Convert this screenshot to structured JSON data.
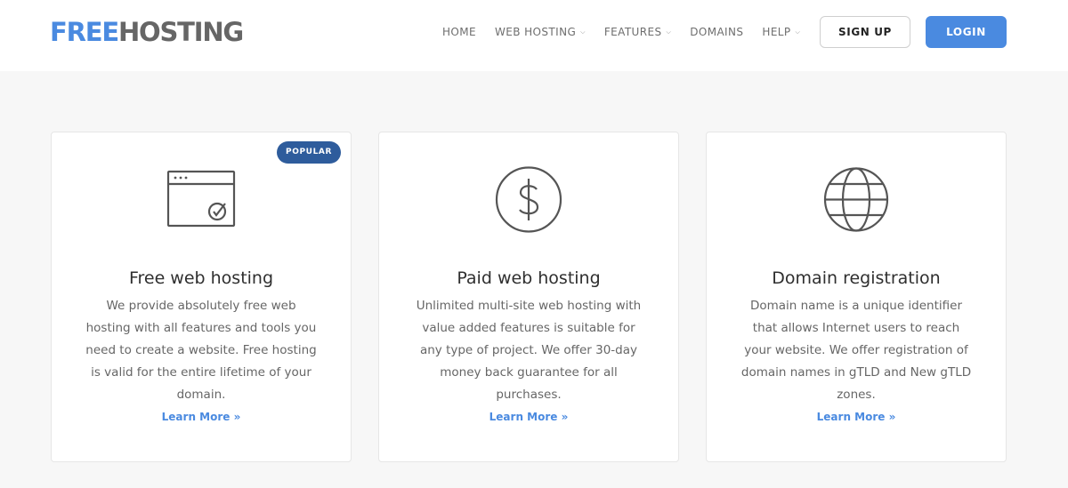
{
  "brand": {
    "logo_part1": "FREE",
    "logo_part2": "HOSTING",
    "primary_color": "#4a8ae0",
    "secondary_color": "#666666"
  },
  "nav": {
    "items": [
      {
        "label": "HOME",
        "has_dropdown": false
      },
      {
        "label": "WEB HOSTING",
        "has_dropdown": true
      },
      {
        "label": "FEATURES",
        "has_dropdown": true
      },
      {
        "label": "DOMAINS",
        "has_dropdown": false
      },
      {
        "label": "HELP",
        "has_dropdown": true
      }
    ]
  },
  "auth": {
    "signup_label": "SIGN UP",
    "login_label": "LOGIN"
  },
  "cards": [
    {
      "icon": "browser-check-icon",
      "badge": "POPULAR",
      "title": "Free web hosting",
      "description": "We provide absolutely free web hosting with all features and tools you need to create a website. Free hosting is valid for the entire lifetime of your domain.",
      "link": "Learn More »"
    },
    {
      "icon": "dollar-circle-icon",
      "title": "Paid web hosting",
      "description": "Unlimited multi-site web hosting with value added features is suitable for any type of project. We offer 30-day money back guarantee for all purchases.",
      "link": "Learn More »"
    },
    {
      "icon": "globe-icon",
      "title": "Domain registration",
      "description": "Domain name is a unique identifier that allows Internet users to reach your website. We offer registration of domain names in gTLD and New gTLD zones.",
      "link": "Learn More »"
    }
  ]
}
